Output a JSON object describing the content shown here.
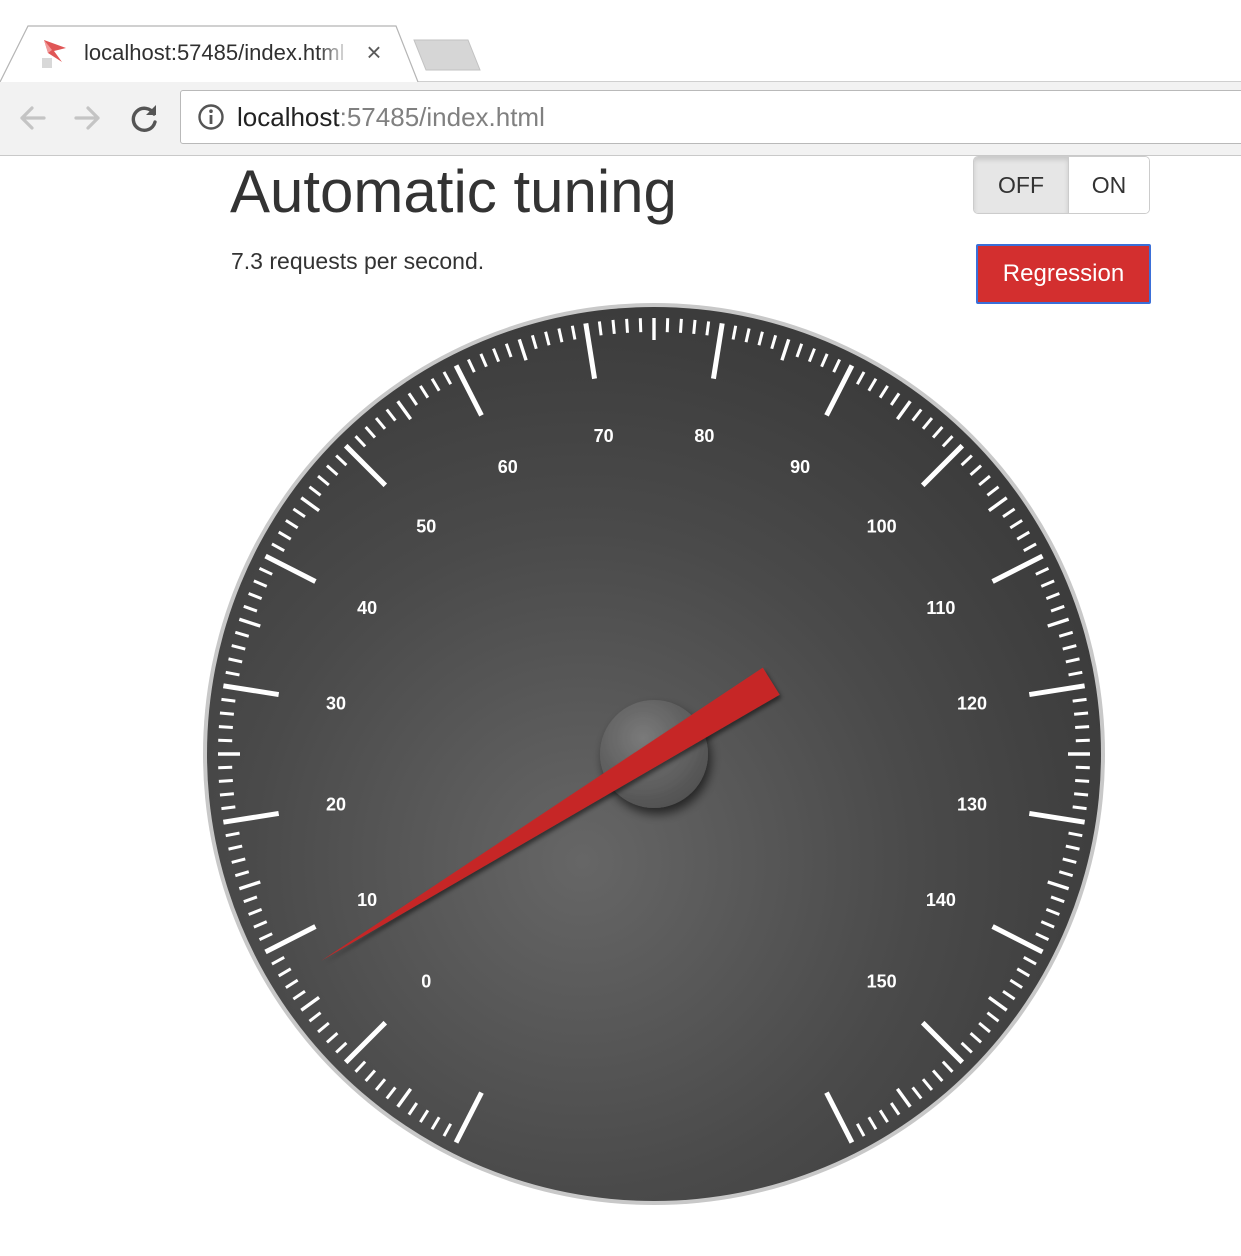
{
  "browser": {
    "tab_title": "localhost:57485/index.html",
    "url_host": "localhost",
    "url_rest": ":57485/index.html"
  },
  "page": {
    "title": "Automatic tuning",
    "rate_text": "7.3 requests per second."
  },
  "toggle": {
    "off_label": "OFF",
    "on_label": "ON",
    "selected": "OFF"
  },
  "regression_button": {
    "label": "Regression",
    "color": "#d32f2f"
  },
  "gauge": {
    "value": 7.3,
    "min": 0,
    "max": 150,
    "major_step": 10,
    "minor_per_major": 10,
    "labels": [
      "0",
      "10",
      "20",
      "30",
      "40",
      "50",
      "60",
      "70",
      "80",
      "90",
      "100",
      "110",
      "120",
      "130",
      "140",
      "150"
    ],
    "needle_color": "#c62828",
    "face_color": "#444444",
    "tick_color": "#ffffff",
    "label_color": "#ffffff"
  }
}
